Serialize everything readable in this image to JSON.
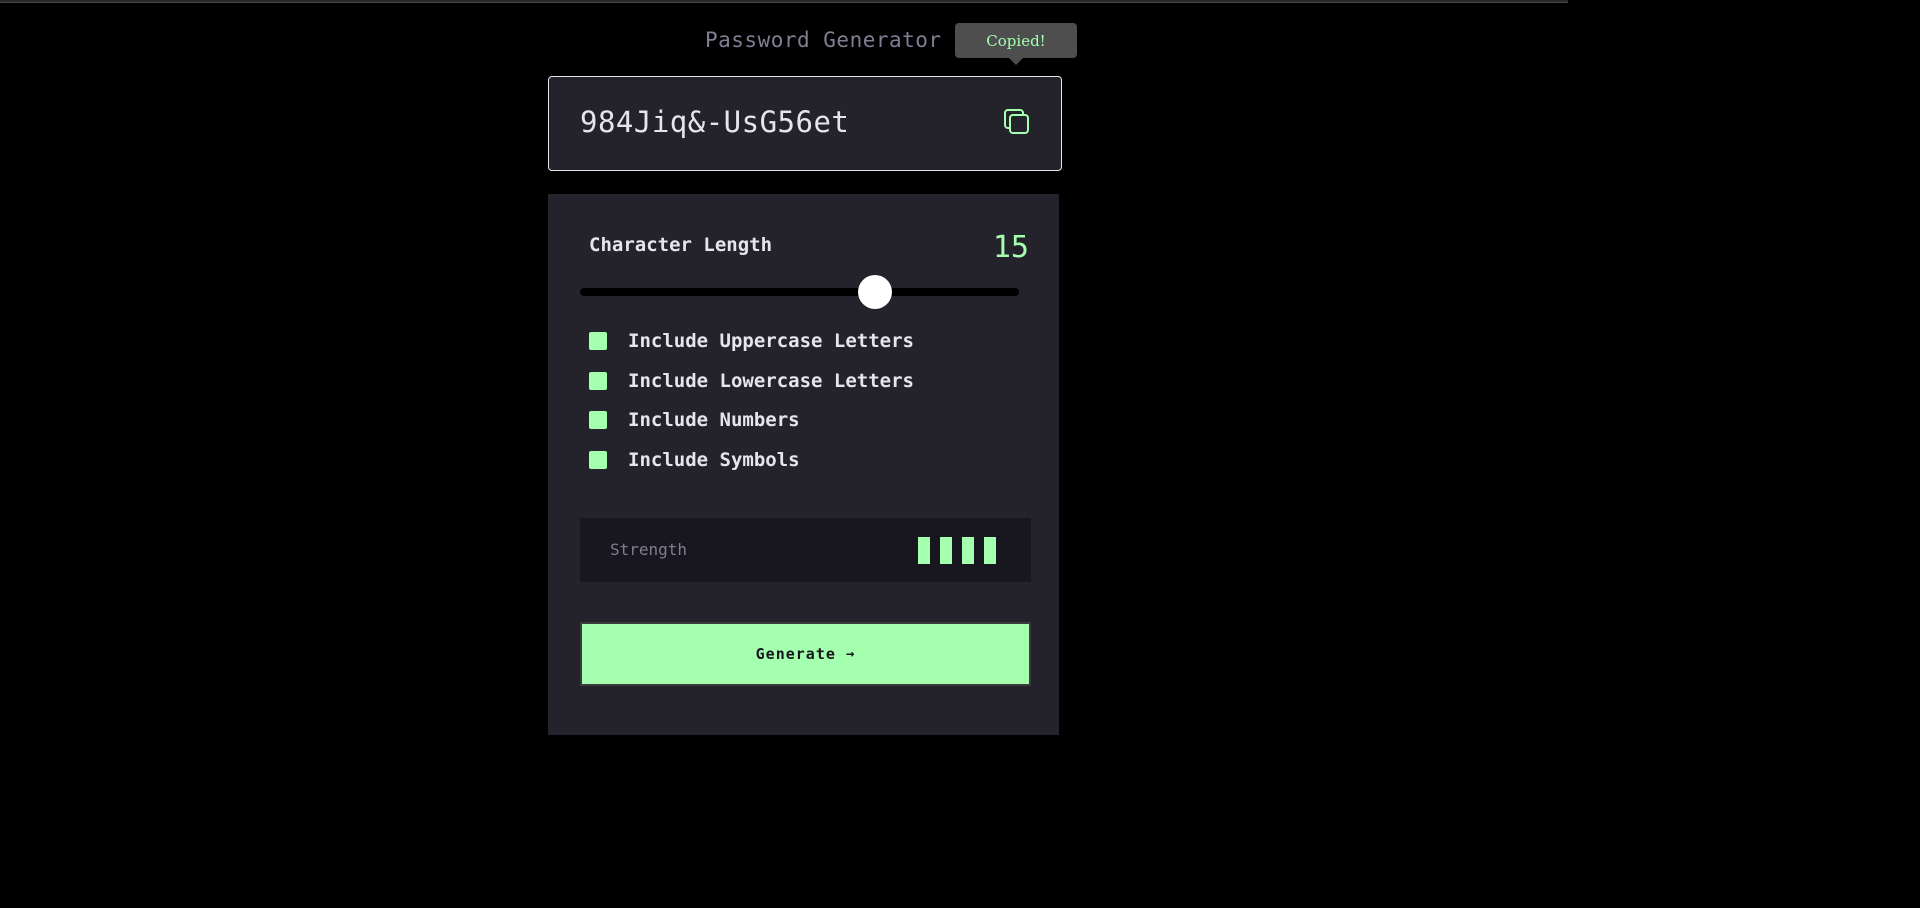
{
  "header": {
    "title": "Password Generator"
  },
  "tooltip": {
    "text": "Copied!"
  },
  "output": {
    "password": "984Jiq&-UsG56et",
    "copy_icon": "copy-icon"
  },
  "length": {
    "label": "Character Length",
    "value": "15",
    "slider_fraction": 0.67
  },
  "options": [
    {
      "label": "Include Uppercase Letters",
      "checked": true
    },
    {
      "label": "Include Lowercase Letters",
      "checked": true
    },
    {
      "label": "Include Numbers",
      "checked": true
    },
    {
      "label": "Include Symbols",
      "checked": true
    }
  ],
  "strength": {
    "label": "Strength",
    "level": 4,
    "max": 4
  },
  "generate": {
    "label": "Generate",
    "icon": "arrow-right-icon"
  },
  "colors": {
    "accent": "#a4ffaf",
    "panel": "#24232c",
    "strength_bg": "#18171f",
    "muted": "#817d92",
    "text": "#e6e5ea"
  }
}
